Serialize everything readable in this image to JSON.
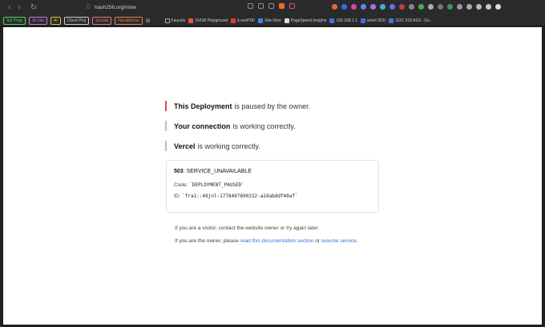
{
  "browser": {
    "url": "hash256.org/mine"
  },
  "bookmarks": {
    "chips": [
      {
        "label": "Sol Projs",
        "color": "#58d05b"
      },
      {
        "label": "Zk tuts",
        "color": "#c77ddb"
      },
      {
        "label": "AI",
        "color": "#e0c24a"
      },
      {
        "label": "Cloud Proj",
        "color": "#cfcfd3"
      },
      {
        "label": "Socials",
        "color": "#e07a7a"
      },
      {
        "label": "Hacakthons",
        "color": "#e0874a"
      }
    ],
    "links": [
      "Faucets",
      "SVGR Playground",
      "iLovePDF",
      "Site-Shot",
      "PageSpeed Insights",
      "192.168.1.1",
      "airtel ODU",
      "SOC 318 ASS - Go..."
    ]
  },
  "page": {
    "lines": [
      {
        "bold": "This Deployment",
        "text": "is paused by the owner.",
        "color": "#e04848"
      },
      {
        "bold": "Your connection",
        "text": "is working correctly.",
        "color": "#a9cbb0"
      },
      {
        "bold": "Vercel",
        "text": "is working correctly.",
        "color": "#a9cbb0"
      }
    ],
    "error": {
      "code_number": "503",
      "code_name": ": SERVICE_UNAVAILABLE",
      "code_label": "Code: ",
      "code_value": "`DEPLOYMENT_PAUSED`",
      "id_label": "ID: ",
      "id_value": "`fra1::49jnl-1778497890332-a2dabddf40af`"
    },
    "visitor_text": "If you are a visitor, contact the website owner or try again later.",
    "owner_prefix": "If you are the owner, please ",
    "owner_link1": "read this documentation section",
    "owner_mid": " or ",
    "owner_link2": "resume service",
    "owner_suffix": "."
  }
}
